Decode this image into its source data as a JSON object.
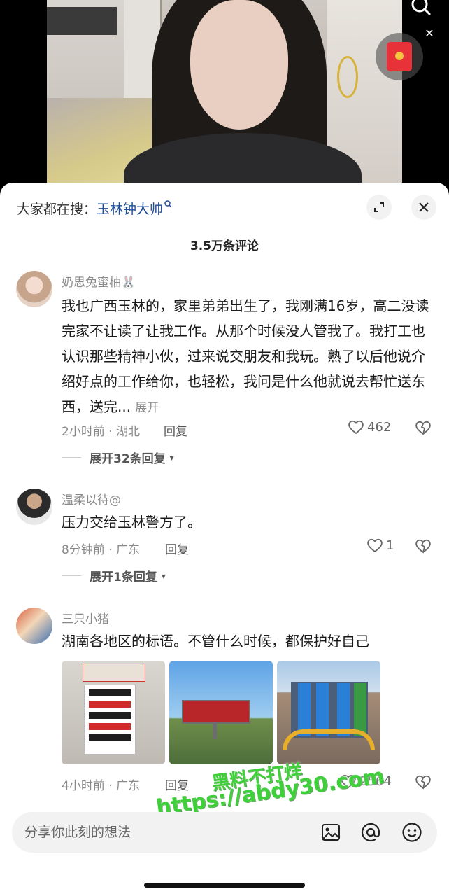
{
  "search_hint": {
    "prefix": "大家都在搜：",
    "keyword": "玉林钟大帅"
  },
  "comments_count": "3.5万条评论",
  "comments": [
    {
      "username": "奶思兔蜜柚🐰",
      "text": "我也广西玉林的，家里弟弟出生了，我刚满16岁，高二没读完家不让读了让我工作。从那个时候没人管我了。我打工也认识那些精神小伙，过来说交朋友和我玩。熟了以后他说介绍好点的工作给你，也轻松，我问是什么他就说去帮忙送东西，送完...",
      "more": "展开",
      "time_location": "2小时前 · 湖北",
      "reply": "回复",
      "likes": "462",
      "expand_replies": "展开32条回复"
    },
    {
      "username": "温柔以待@",
      "text": "压力交给玉林警方了。",
      "time_location": "8分钟前 · 广东",
      "reply": "回复",
      "likes": "1",
      "expand_replies": "展开1条回复"
    },
    {
      "username": "三只小猪",
      "text": "湖南各地区的标语。不管什么时候，都保护好自己",
      "time_location": "4小时前 · 广东",
      "reply": "回复",
      "likes": "2564",
      "images": [
        "poster-photo",
        "billboard-photo",
        "mall-photo"
      ]
    }
  ],
  "watermark": {
    "line1": "黑料不打烊",
    "line2": "https://abdy30.com"
  },
  "input": {
    "placeholder": "分享你此刻的想法"
  },
  "icons": [
    "search-icon",
    "close-icon",
    "red-packet-icon",
    "expand-icon",
    "heart-icon",
    "broken-heart-icon",
    "image-icon",
    "at-icon",
    "emoji-icon"
  ],
  "colors": {
    "link_blue": "#1e4b9a",
    "watermark_green": "#3fcf3a",
    "red_packet": "#e8323a"
  }
}
